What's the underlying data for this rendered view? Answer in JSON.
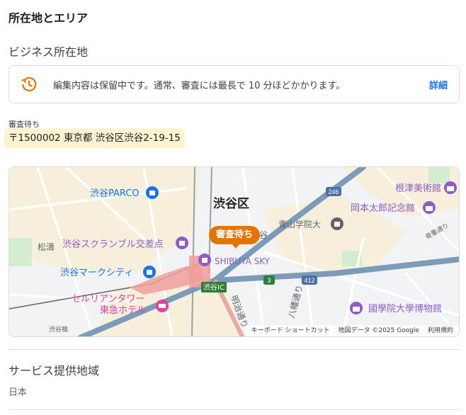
{
  "section": {
    "title": "所在地とエリア"
  },
  "business_address": {
    "title": "ビジネス所在地",
    "notice": {
      "text": "編集内容は保留中です。通常、審査には最長で 10 分ほどかかります。",
      "link": "詳細",
      "icon": "pending-clock-icon",
      "icon_color": "#e37400"
    },
    "pending_label": "審査待ち",
    "address": "〒1500002 東京都 渋谷区渋谷2-19-15",
    "highlight_color": "#fdf3d0"
  },
  "map": {
    "pin_label": "審査待ち",
    "pin_color": "#e37400",
    "place_labels": {
      "district": "渋谷区",
      "shibuya_parco": "渋谷PARCO",
      "nezu_museum": "根津美術館",
      "okamoto_memorial": "岡本太郎記念館",
      "aoyama_university": "青山学院大",
      "aoyama_fragment": "谷",
      "shoto": "松濤",
      "scramble_crossing": "渋谷スクランブル交差点",
      "shibuya_sky": "SHIBUYA SKY",
      "mark_city": "渋谷マークシティ",
      "cerulean_tower": "セルリアンタワー",
      "tokyu_hotel": "東急ホテル",
      "kokugakuin_museum": "國學院大學博物館",
      "shibuya_ic": "渋谷IC",
      "meiji_dori": "明治通り",
      "hachiman_dori": "八幡通り",
      "kotto_dori": "骨董通り",
      "shibuya_bashi": "渋谷橋",
      "route_246": "246",
      "route_412": "412",
      "route_3": "3"
    },
    "footer": {
      "shortcuts": "キーボード ショートカット",
      "map_data": "地図データ ©2025 Google",
      "terms": "利用規約"
    }
  },
  "service_area": {
    "title": "サービス提供地域",
    "value": "日本"
  }
}
